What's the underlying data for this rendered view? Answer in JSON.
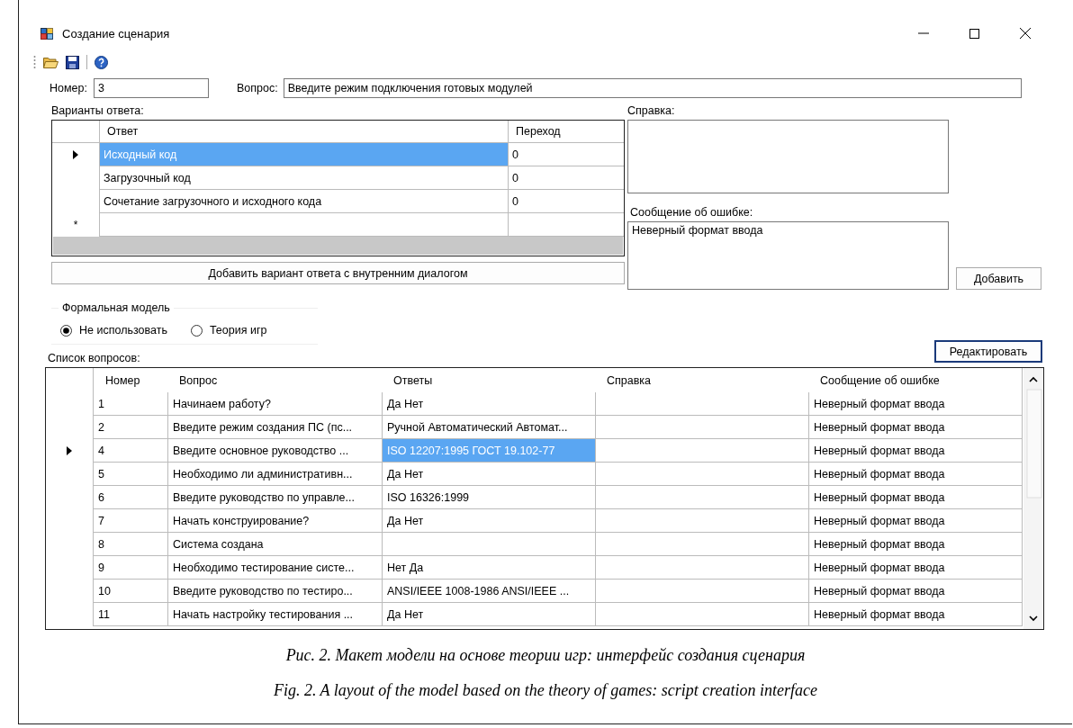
{
  "window": {
    "title": "Создание сценария"
  },
  "fields": {
    "number_label": "Номер:",
    "number_value": "3",
    "question_label": "Вопрос:",
    "question_value": "Введите режим подключения готовых модулей"
  },
  "answers": {
    "label": "Варианты ответа:",
    "columns": [
      "Ответ",
      "Переход"
    ],
    "new_row_marker": "*",
    "rows": [
      {
        "answer": "Исходный код",
        "jump": "0",
        "selected": true
      },
      {
        "answer": "Загрузочный код",
        "jump": "0",
        "selected": false
      },
      {
        "answer": "Сочетание загрузочного и исходного кода",
        "jump": "0",
        "selected": false
      }
    ],
    "add_button": "Добавить вариант ответа с внутренним диалогом"
  },
  "help": {
    "label": "Справка:"
  },
  "error": {
    "label": "Сообщение об ошибке:",
    "value": "Неверный формат ввода"
  },
  "add_button": "Добавить",
  "model": {
    "title": "Формальная модель",
    "options": [
      {
        "label": "Не использовать",
        "selected": true
      },
      {
        "label": "Теория игр",
        "selected": false
      }
    ]
  },
  "questions": {
    "label": "Список вопросов:",
    "edit_button": "Редактировать",
    "columns": [
      "Номер",
      "Вопрос",
      "Ответы",
      "Справка",
      "Сообщение об ошибке"
    ],
    "rows": [
      {
        "number": "1",
        "question": "Начинаем работу?",
        "answers": "Да Нет",
        "error": "Неверный формат ввода",
        "selected": false
      },
      {
        "number": "2",
        "question": "Введите режим создания ПС (пс...",
        "answers": "Ручной Автоматический Автомат...",
        "error": "Неверный формат ввода",
        "selected": false
      },
      {
        "number": "4",
        "question": "Введите основное руководство ...",
        "answers": "ISO 12207:1995 ГОСТ 19.102-77",
        "error": "Неверный формат ввода",
        "selected": true
      },
      {
        "number": "5",
        "question": "Необходимо ли административн...",
        "answers": "Да Нет",
        "error": "Неверный формат ввода",
        "selected": false
      },
      {
        "number": "6",
        "question": "Введите руководство по управле...",
        "answers": "ISO 16326:1999",
        "error": "Неверный формат ввода",
        "selected": false
      },
      {
        "number": "7",
        "question": "Начать конструирование?",
        "answers": "Да Нет",
        "error": "Неверный формат ввода",
        "selected": false
      },
      {
        "number": "8",
        "question": "Система создана",
        "error": "Неверный формат ввода",
        "selected": false
      },
      {
        "number": "9",
        "question": "Необходимо тестирование систе...",
        "answers": "Нет Да",
        "error": "Неверный формат ввода",
        "selected": false
      },
      {
        "number": "10",
        "question": "Введите руководство по тестиро...",
        "answers": "ANSI/IEEE 1008-1986 ANSI/IEEE ...",
        "error": "Неверный формат ввода",
        "selected": false
      },
      {
        "number": "11",
        "question": "Начать настройку тестирования ...",
        "answers": "Да Нет",
        "error": "Неверный формат ввода",
        "selected": false
      }
    ]
  },
  "captions": [
    "Рис. 2. Макет модели на основе теории игр: интерфейс создания сценария",
    "Fig. 2. A layout of the model based on the theory of games: script creation interface"
  ]
}
